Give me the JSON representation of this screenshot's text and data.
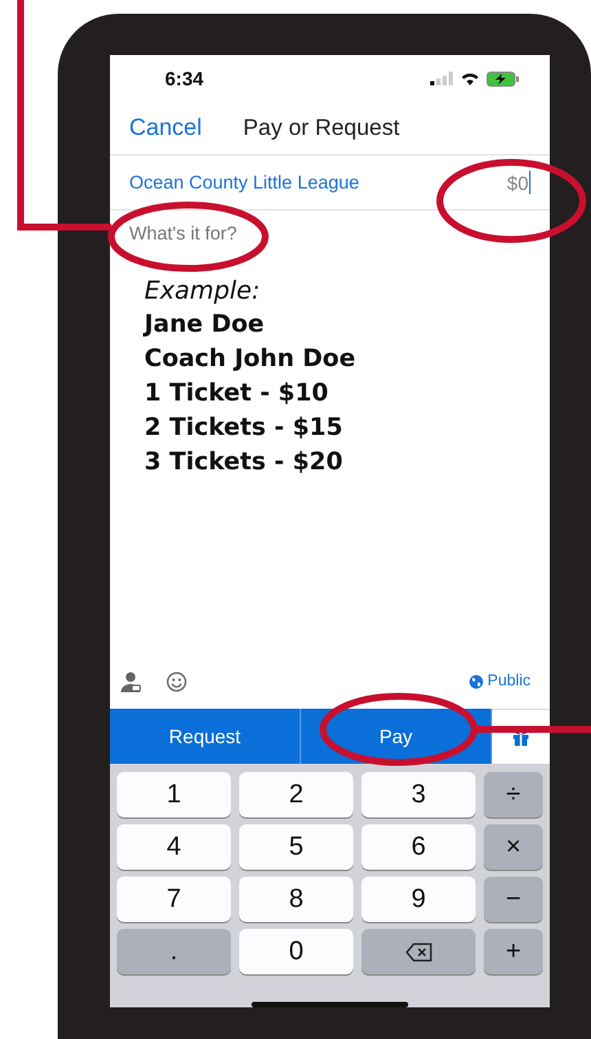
{
  "status_bar": {
    "time": "6:34"
  },
  "nav": {
    "cancel": "Cancel",
    "title": "Pay or Request"
  },
  "recipient": {
    "name": "Ocean County Little League",
    "amount": "$0"
  },
  "note_field": {
    "placeholder": "What's it for?"
  },
  "example": [
    {
      "text": "Example:",
      "kind": "heading"
    },
    {
      "text": "Jane Doe",
      "kind": "line"
    },
    {
      "text": "Coach John Doe",
      "kind": "line"
    },
    {
      "text": "1 Ticket - $10",
      "kind": "line"
    },
    {
      "text": "2 Tickets - $15",
      "kind": "line"
    },
    {
      "text": "3 Tickets - $20",
      "kind": "line"
    }
  ],
  "toolbar": {
    "privacy": "Public"
  },
  "actions": [
    {
      "label": "Request"
    },
    {
      "label": "Pay"
    }
  ],
  "keypad": [
    {
      "label": "1",
      "kind": "digit"
    },
    {
      "label": "2",
      "kind": "digit"
    },
    {
      "label": "3",
      "kind": "digit"
    },
    {
      "label": "÷",
      "kind": "op"
    },
    {
      "label": "4",
      "kind": "digit"
    },
    {
      "label": "5",
      "kind": "digit"
    },
    {
      "label": "6",
      "kind": "digit"
    },
    {
      "label": "×",
      "kind": "op"
    },
    {
      "label": "7",
      "kind": "digit"
    },
    {
      "label": "8",
      "kind": "digit"
    },
    {
      "label": "9",
      "kind": "digit"
    },
    {
      "label": "−",
      "kind": "op"
    },
    {
      "label": ".",
      "kind": "op"
    },
    {
      "label": "0",
      "kind": "digit"
    },
    {
      "kind": "delete"
    },
    {
      "label": "+",
      "kind": "op"
    }
  ]
}
